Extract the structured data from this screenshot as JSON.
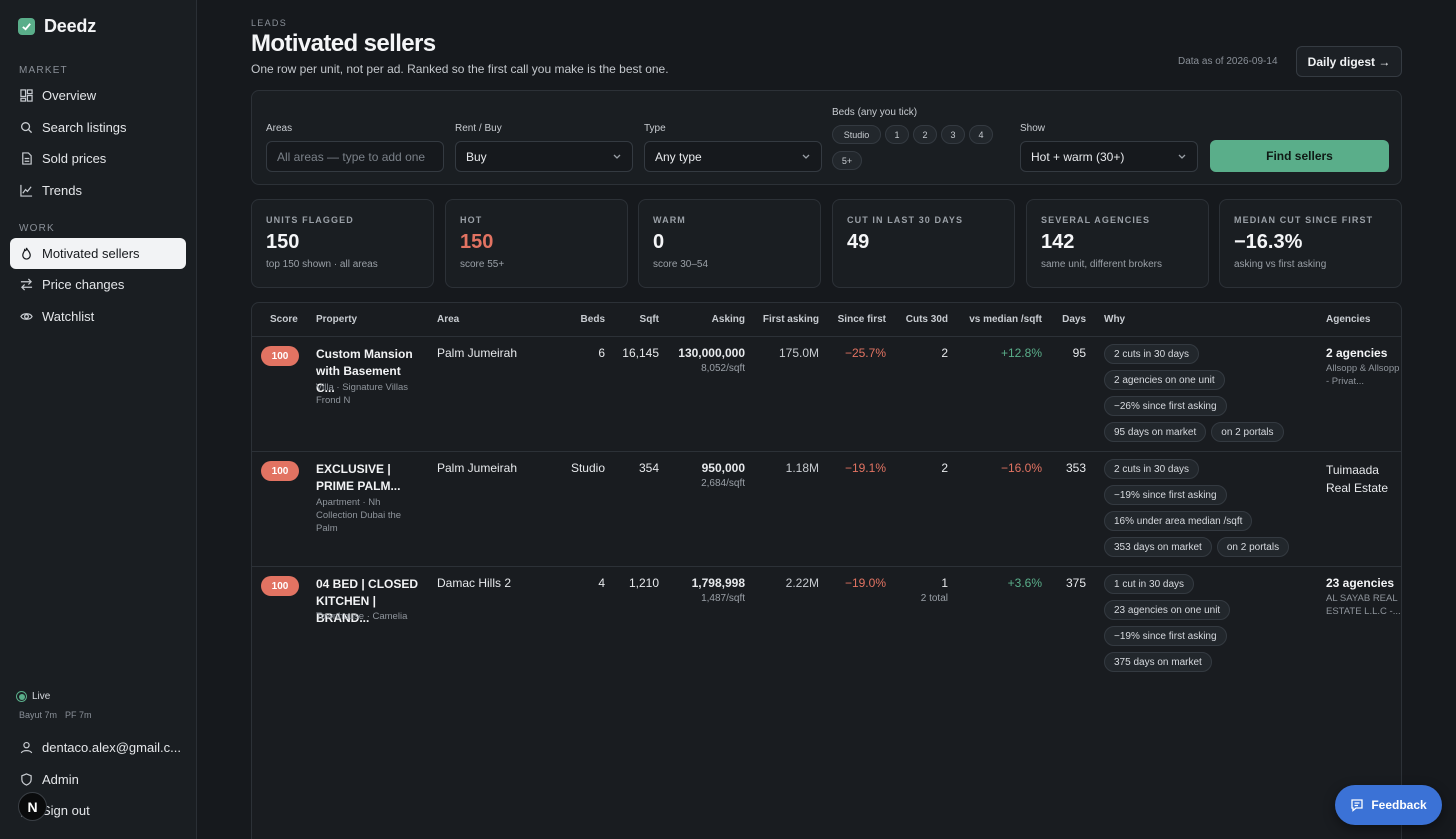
{
  "brand": {
    "name": "Deedz"
  },
  "sidebar": {
    "market_label": "MARKET",
    "market_items": [
      {
        "label": "Overview",
        "icon": "grid-icon"
      },
      {
        "label": "Search listings",
        "icon": "search-icon"
      },
      {
        "label": "Sold prices",
        "icon": "document-icon"
      },
      {
        "label": "Trends",
        "icon": "trend-icon"
      }
    ],
    "work_label": "WORK",
    "work_items": [
      {
        "label": "Motivated sellers",
        "icon": "flame-icon",
        "active": true
      },
      {
        "label": "Price changes",
        "icon": "arrows-icon"
      },
      {
        "label": "Watchlist",
        "icon": "eye-icon"
      }
    ],
    "live_label": "Live",
    "source_1": "Bayut 7m",
    "source_2": "PF 7m",
    "user_email": "dentaco.alex@gmail.c...",
    "admin_label": "Admin",
    "signout_label": "Sign out",
    "n_badge": "N"
  },
  "header": {
    "eyebrow": "LEADS",
    "title": "Motivated sellers",
    "subtitle": "One row per unit, not per ad. Ranked so the first call you make is the best one.",
    "data_as_of": "Data as of 2026-09-14",
    "digest_button": "Daily digest →"
  },
  "filters": {
    "areas_label": "Areas",
    "areas_placeholder": "All areas — type to add one",
    "rentbuy_label": "Rent / Buy",
    "rentbuy_value": "Buy",
    "type_label": "Type",
    "type_value": "Any type",
    "beds_label": "Beds (any you tick)",
    "beds": [
      "Studio",
      "1",
      "2",
      "3",
      "4",
      "5+"
    ],
    "show_label": "Show",
    "show_value": "Hot + warm (30+)",
    "find_button": "Find sellers"
  },
  "stats": [
    {
      "label": "UNITS FLAGGED",
      "value": "150",
      "sub": "top 150 shown · all areas"
    },
    {
      "label": "HOT",
      "value": "150",
      "sub": "score 55+",
      "hot": true
    },
    {
      "label": "WARM",
      "value": "0",
      "sub": "score 30–54"
    },
    {
      "label": "CUT IN LAST 30 DAYS",
      "value": "49",
      "sub": ""
    },
    {
      "label": "SEVERAL AGENCIES",
      "value": "142",
      "sub": "same unit, different brokers"
    },
    {
      "label": "MEDIAN CUT SINCE FIRST",
      "value": "−16.3%",
      "sub": "asking vs first asking"
    }
  ],
  "table": {
    "headers": {
      "score": "Score",
      "property": "Property",
      "area": "Area",
      "beds": "Beds",
      "sqft": "Sqft",
      "asking": "Asking",
      "first_asking": "First asking",
      "since_first": "Since first",
      "cuts_30d": "Cuts 30d",
      "vs_median": "vs median /sqft",
      "days": "Days",
      "why": "Why",
      "agencies": "Agencies"
    },
    "rows": [
      {
        "score": "100",
        "title": "Custom Mansion with Basement C...",
        "sub": "Villa · Signature Villas Frond N",
        "area": "Palm Jumeirah",
        "beds": "6",
        "sqft": "16,145",
        "asking": "130,000,000",
        "asking_sqft": "8,052/sqft",
        "first_asking": "175.0M",
        "since_first": "−25.7%",
        "cuts": "2",
        "cuts_sub": "",
        "vs_median": "+12.8%",
        "days": "95",
        "why": [
          "2 cuts in 30 days",
          "2 agencies on one unit",
          "−26% since first asking",
          "95 days on market",
          "on 2 portals"
        ],
        "agency_main": "2 agencies",
        "agency_sub": "Allsopp & Allsopp - Privat..."
      },
      {
        "score": "100",
        "title": "EXCLUSIVE | PRIME PALM...",
        "sub": "Apartment · Nh Collection Dubai the Palm",
        "area": "Palm Jumeirah",
        "beds": "Studio",
        "sqft": "354",
        "asking": "950,000",
        "asking_sqft": "2,684/sqft",
        "first_asking": "1.18M",
        "since_first": "−19.1%",
        "cuts": "2",
        "cuts_sub": "",
        "vs_median": "−16.0%",
        "days": "353",
        "why": [
          "2 cuts in 30 days",
          "−19% since first asking",
          "16% under area median /sqft",
          "353 days on market",
          "on 2 portals"
        ],
        "agency_plain": "Tuimaada Real Estate"
      },
      {
        "score": "100",
        "title": "04 BED | CLOSED KITCHEN | BRAND...",
        "sub": "Townhouse · Camelia",
        "area": "Damac Hills 2",
        "beds": "4",
        "sqft": "1,210",
        "asking": "1,798,998",
        "asking_sqft": "1,487/sqft",
        "first_asking": "2.22M",
        "since_first": "−19.0%",
        "cuts": "1",
        "cuts_sub": "2 total",
        "vs_median": "+3.6%",
        "days": "375",
        "why": [
          "1 cut in 30 days",
          "23 agencies on one unit",
          "−19% since first asking",
          "375 days on market"
        ],
        "agency_main": "23 agencies",
        "agency_sub": "AL SAYAB REAL ESTATE L.L.C -..."
      }
    ]
  },
  "feedback_button": "Feedback",
  "colors": {
    "accent": "#5aae8a",
    "hot": "#e27362",
    "positive": "#5aae8a",
    "feedback": "#3b72d6"
  }
}
